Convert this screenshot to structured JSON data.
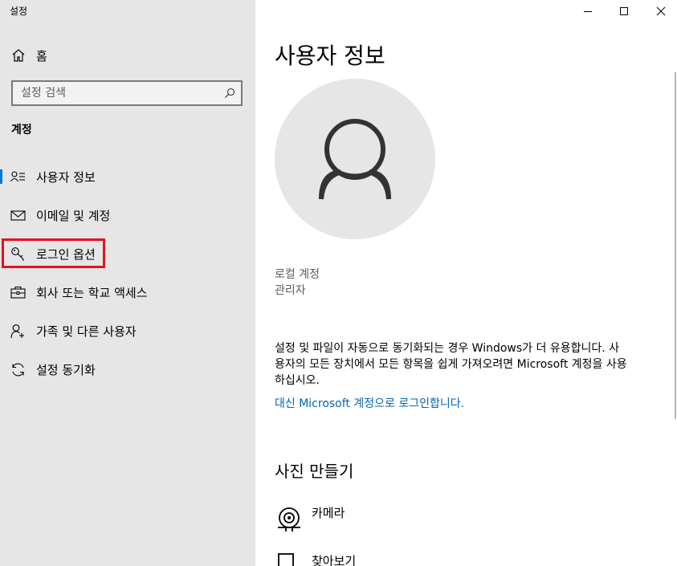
{
  "app": {
    "title": "설정"
  },
  "sidebar": {
    "home_label": "홈",
    "search_placeholder": "설정 검색",
    "section_title": "계정",
    "items": [
      {
        "label": "사용자 정보",
        "icon": "user-info-icon",
        "active": true
      },
      {
        "label": "이메일 및 계정",
        "icon": "mail-icon",
        "active": false
      },
      {
        "label": "로그인 옵션",
        "icon": "key-icon",
        "active": false,
        "highlighted": true
      },
      {
        "label": "회사 또는 학교 액세스",
        "icon": "briefcase-icon",
        "active": false
      },
      {
        "label": "가족 및 다른 사용자",
        "icon": "person-add-icon",
        "active": false
      },
      {
        "label": "설정 동기화",
        "icon": "sync-icon",
        "active": false
      }
    ]
  },
  "main": {
    "title": "사용자 정보",
    "account_type": "로컬 계정",
    "account_role": "관리자",
    "info_text": "설정 및 파일이 자동으로 동기화되는 경우 Windows가 더 유용합니다. 사용자의 모든 장치에서 모든 항목을 쉽게 가져오려면 Microsoft 계정을 사용하십시오.",
    "ms_link": "대신 Microsoft 계정으로 로그인합니다.",
    "create_picture_heading": "사진 만들기",
    "options": [
      {
        "label": "카메라",
        "icon": "camera-icon"
      },
      {
        "label": "찾아보기",
        "icon": "browse-icon"
      }
    ]
  },
  "colors": {
    "accent": "#0078d7",
    "link": "#0066b4",
    "highlight": "#e81123",
    "sidebar_bg": "#e6e6e6"
  }
}
